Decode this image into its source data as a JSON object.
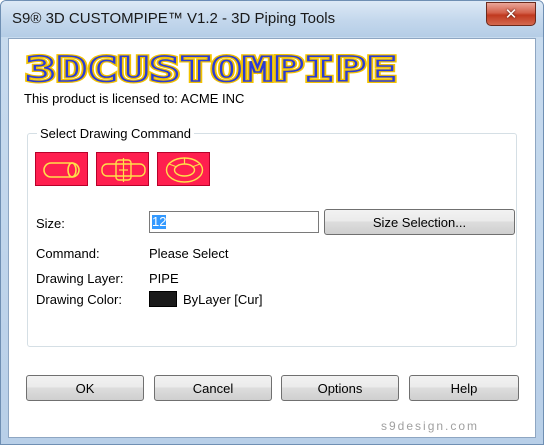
{
  "window": {
    "title": "S9® 3D CUSTOMPIPE™ V1.2 - 3D Piping Tools",
    "close_glyph": "✕"
  },
  "logo": {
    "text": "3DCUSTOMPIPE"
  },
  "license": {
    "text": "This product is licensed to: ACME INC"
  },
  "group": {
    "title": "Select Drawing Command",
    "command_buttons": [
      {
        "icon": "pipe-cylinder-icon"
      },
      {
        "icon": "pipe-flange-icon"
      },
      {
        "icon": "pipe-elbow-icon"
      }
    ]
  },
  "fields": {
    "size_label": "Size:",
    "size_value": "12",
    "size_selection_button": "Size Selection...",
    "command_label": "Command:",
    "command_value": "Please Select",
    "layer_label": "Drawing Layer:",
    "layer_value": "PIPE",
    "color_label": "Drawing Color:",
    "color_value": "ByLayer [Cur]",
    "color_swatch": "#1a1a1a"
  },
  "buttons": {
    "ok": "OK",
    "cancel": "Cancel",
    "options": "Options",
    "help": "Help"
  },
  "footer": {
    "site": "s9design.com"
  },
  "colors": {
    "accent_red": "#ff1f4f",
    "logo_blue": "#2a3bd6",
    "logo_yellow": "#f2c200"
  }
}
